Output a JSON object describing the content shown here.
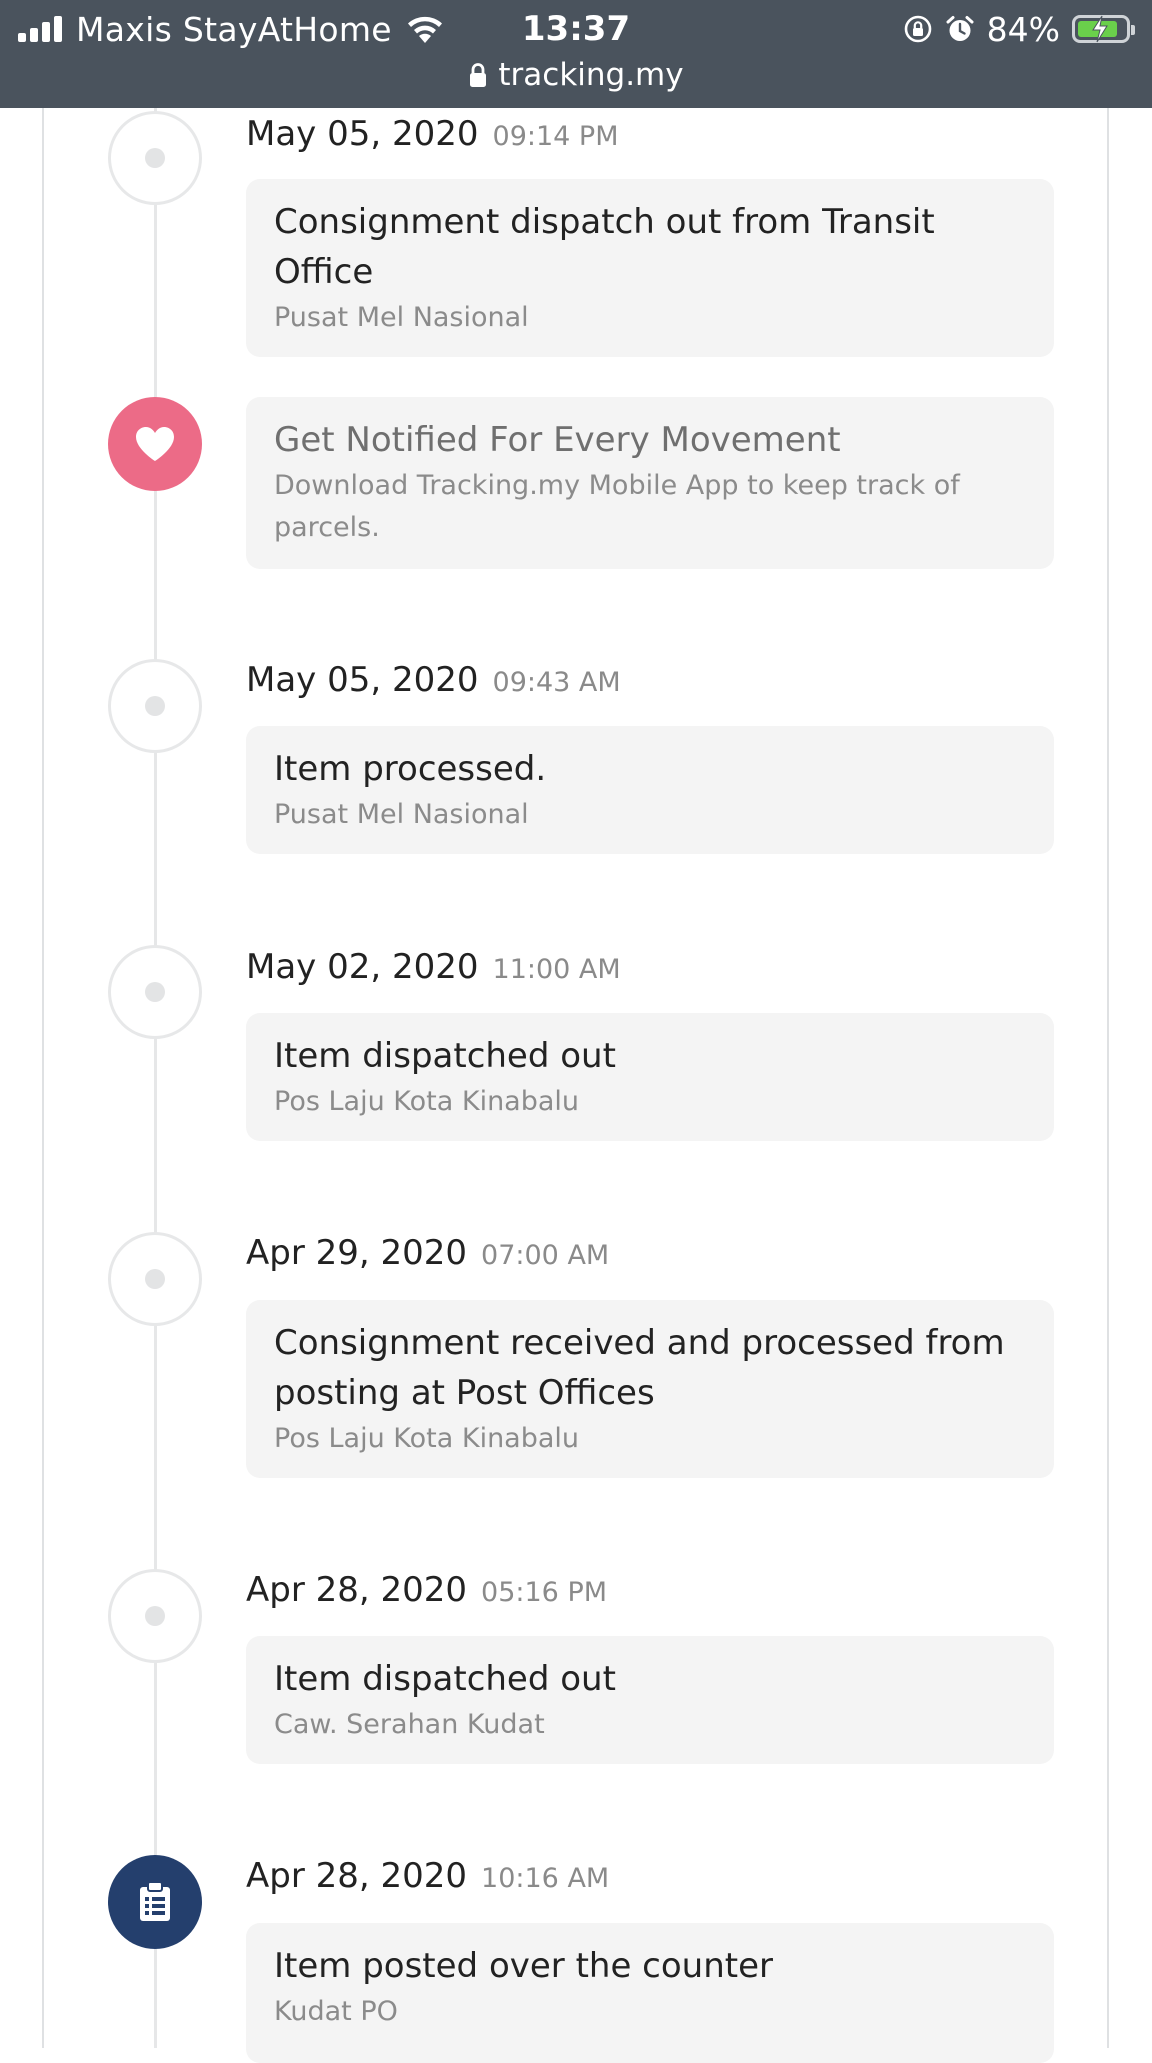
{
  "status_bar": {
    "carrier": "Maxis StayAtHome",
    "time": "13:37",
    "battery": "84%",
    "battery_level": 0.84,
    "battery_color": "#6ad04b",
    "url": "tracking.my",
    "icons": [
      "signal-icon",
      "wifi-icon",
      "orientation-lock-icon",
      "alarm-icon",
      "battery-icon",
      "lock-icon"
    ]
  },
  "colors": {
    "promo_node": "#ec6b87",
    "posted_node": "#243f6d"
  },
  "events": [
    {
      "date": "May 05, 2020",
      "time": "09:14 PM",
      "title": "Consignment dispatch out from Transit Office",
      "location": "Pusat Mel Nasional",
      "icon": "dot-icon"
    },
    {
      "promo": true,
      "title": "Get Notified For Every Movement",
      "text": "Download Tracking.my Mobile App to keep track of parcels.",
      "icon": "heart-icon"
    },
    {
      "date": "May 05, 2020",
      "time": "09:43 AM",
      "title": "Item processed.",
      "location": "Pusat Mel Nasional",
      "icon": "dot-icon"
    },
    {
      "date": "May 02, 2020",
      "time": "11:00 AM",
      "title": "Item dispatched out",
      "location": "Pos Laju Kota Kinabalu",
      "icon": "dot-icon"
    },
    {
      "date": "Apr 29, 2020",
      "time": "07:00 AM",
      "title": "Consignment received and processed from posting at Post Offices",
      "location": "Pos Laju Kota Kinabalu",
      "icon": "dot-icon"
    },
    {
      "date": "Apr 28, 2020",
      "time": "05:16 PM",
      "title": "Item dispatched out",
      "location": "Caw. Serahan Kudat",
      "icon": "dot-icon"
    },
    {
      "date": "Apr 28, 2020",
      "time": "10:16 AM",
      "title": "Item posted over the counter",
      "location": "Kudat PO",
      "icon": "clipboard-icon"
    }
  ]
}
